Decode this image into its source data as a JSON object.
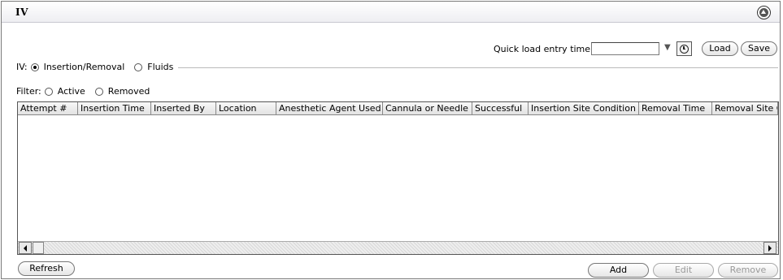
{
  "window": {
    "title": "IV"
  },
  "quick_load": {
    "label": "Quick load entry time:",
    "value": "",
    "dropdown_glyph": "▼",
    "load_label": "Load",
    "save_label": "Save"
  },
  "iv_mode": {
    "label": "IV:",
    "options": [
      {
        "label": "Insertion/Removal",
        "selected": true
      },
      {
        "label": "Fluids",
        "selected": false
      }
    ]
  },
  "filter": {
    "label": "Filter:",
    "options": [
      {
        "label": "Active",
        "selected": false
      },
      {
        "label": "Removed",
        "selected": false
      }
    ]
  },
  "table": {
    "columns": [
      "Attempt #",
      "Insertion Time",
      "Inserted By",
      "Location",
      "Anesthetic Agent Used",
      "Cannula or Needle",
      "Successful",
      "Insertion Site Condition",
      "Removal Time",
      "Removal Site Co"
    ],
    "rows": []
  },
  "actions": {
    "refresh_label": "Refresh",
    "add_label": "Add",
    "edit_label": "Edit",
    "remove_label": "Remove"
  },
  "icons": {
    "collapse": "collapse-up-icon",
    "clock": "clock-icon"
  }
}
